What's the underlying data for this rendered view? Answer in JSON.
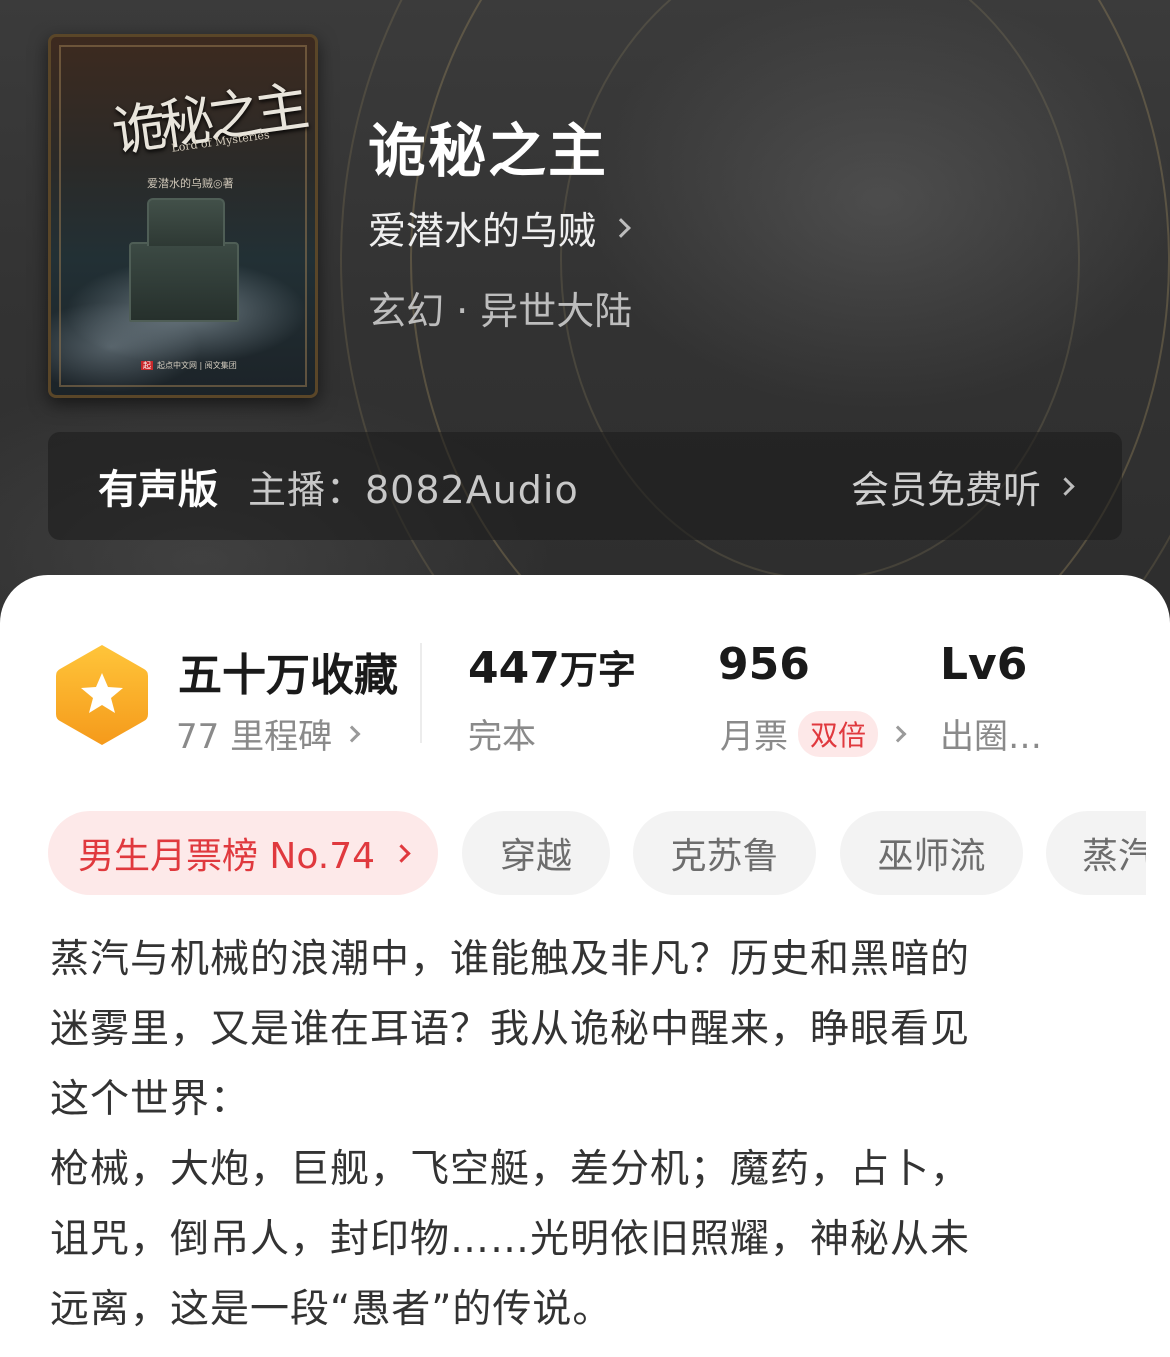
{
  "book": {
    "title": "诡秘之主",
    "author": "爱潜水的乌贼",
    "genre": "玄幻 · 异世大陆",
    "cover": {
      "title_art": "诡秘之主",
      "subtitle": "Lord of Mysteries",
      "author_line": "爱潜水的乌贼◎著",
      "publisher": "起点中文网 | 阅文集团",
      "publisher_mark": "起"
    }
  },
  "audio": {
    "edition_label": "有声版",
    "narrator": "主播：8082Audio",
    "member_label": "会员免费听"
  },
  "stats": {
    "collections": {
      "value": "五十万收藏",
      "label": "77 里程碑"
    },
    "words": {
      "value_num": "447",
      "value_unit": "万字",
      "label": "完本"
    },
    "monthly_votes": {
      "value": "956",
      "label": "月票",
      "badge": "双倍"
    },
    "level": {
      "value": "Lv6",
      "label": "出圈…"
    }
  },
  "tags": [
    {
      "label": "男生月票榜 No.74"
    },
    {
      "label": "穿越"
    },
    {
      "label": "克苏鲁"
    },
    {
      "label": "巫师流"
    },
    {
      "label": "蒸汽"
    }
  ],
  "synopsis": {
    "lines": [
      "蒸汽与机械的浪潮中，谁能触及非凡？历史和黑暗的",
      "迷雾里，又是谁在耳语？我从诡秘中醒来，睁眼看见",
      "这个世界：",
      "枪械，大炮，巨舰，飞空艇，差分机；魔药，占卜，",
      "诅咒，倒吊人，封印物……光明依旧照耀，神秘从未",
      "远离，这是一段“愚者”的传说。"
    ]
  },
  "colors": {
    "accent_red": "#e0393e",
    "badge_orange": "#f6a623",
    "hero_dark": "#333333"
  },
  "icons": {
    "badge": "star-hexagon-icon",
    "chevron": "chevron-right-icon"
  }
}
